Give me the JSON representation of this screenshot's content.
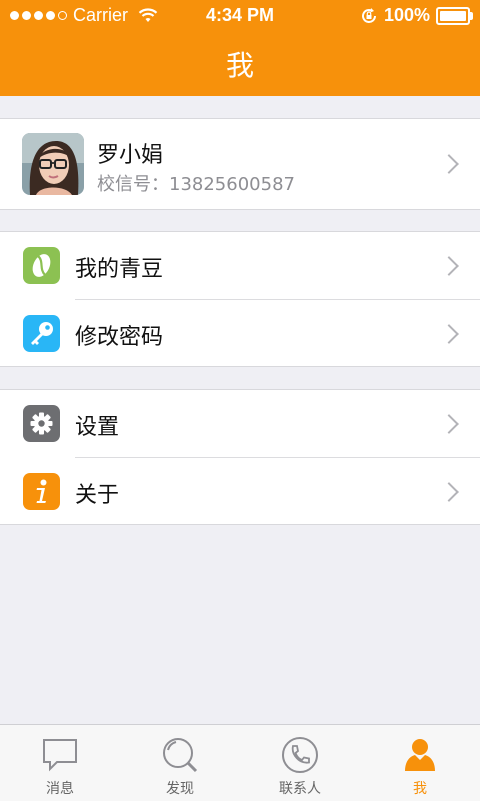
{
  "status_bar": {
    "carrier": "Carrier",
    "time": "4:34 PM",
    "battery": "100%"
  },
  "nav": {
    "title": "我"
  },
  "profile": {
    "name": "罗小娟",
    "id_line": "校信号：13825600587"
  },
  "menu": {
    "qingdou": "我的青豆",
    "change_password": "修改密码",
    "settings": "设置",
    "about": "关于"
  },
  "tabs": [
    {
      "label": "消息"
    },
    {
      "label": "发现"
    },
    {
      "label": "联系人"
    },
    {
      "label": "我"
    }
  ],
  "colors": {
    "accent": "#f7910b",
    "qingdou_icon": "#8cc152",
    "password_icon": "#29b6f6",
    "settings_icon": "#6d6e71",
    "about_icon": "#f7910b"
  }
}
